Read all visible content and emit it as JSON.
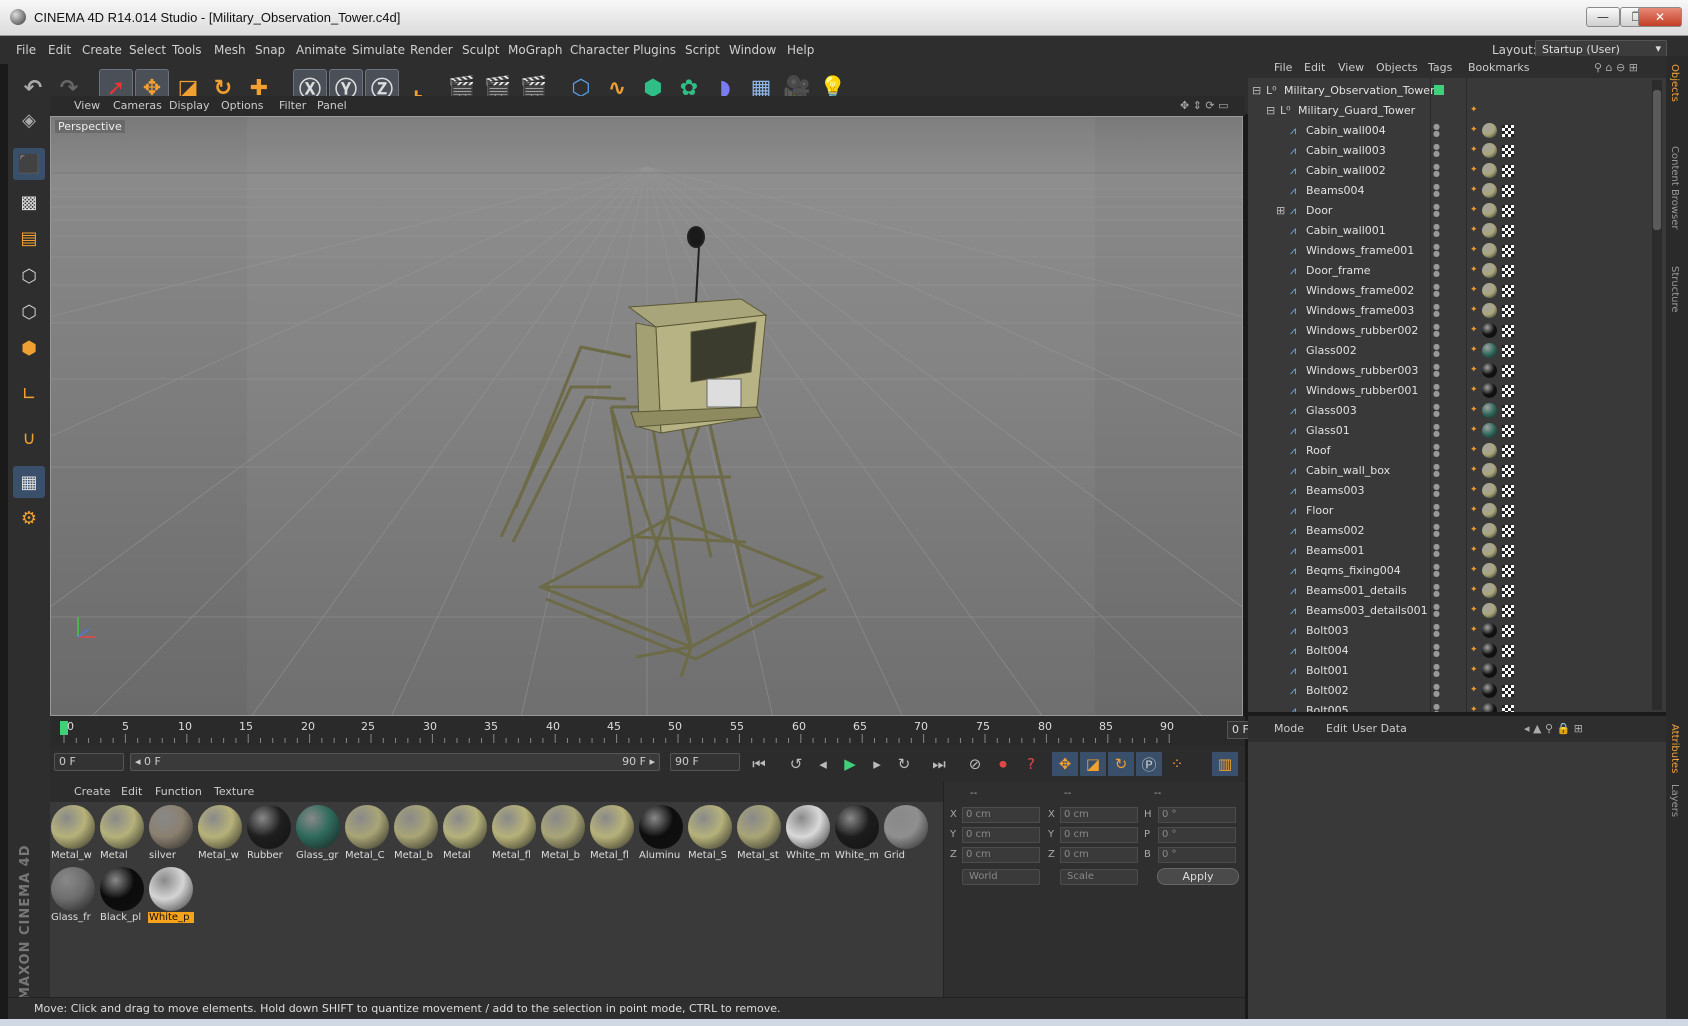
{
  "window": {
    "title": "CINEMA 4D R14.014 Studio - [Military_Observation_Tower.c4d]",
    "minimize": "—",
    "restore": "❐",
    "close": "✕"
  },
  "menubar": {
    "items": [
      "File",
      "Edit",
      "Create",
      "Select",
      "Tools",
      "Mesh",
      "Snap",
      "Animate",
      "Simulate",
      "Render",
      "Sculpt",
      "MoGraph",
      "Character",
      "Plugins",
      "Script",
      "Window",
      "Help"
    ],
    "layout_label": "Layout:",
    "layout_value": "Startup (User)"
  },
  "viewport": {
    "menu": [
      "View",
      "Cameras",
      "Display",
      "Options",
      "Filter",
      "Panel"
    ],
    "label": "Perspective"
  },
  "timeline": {
    "ticks": [
      "0",
      "5",
      "10",
      "15",
      "20",
      "25",
      "30",
      "35",
      "40",
      "45",
      "50",
      "55",
      "60",
      "65",
      "70",
      "75",
      "80",
      "85",
      "90"
    ],
    "current_frame": "0 F"
  },
  "transport": {
    "start_field": "0 F",
    "range_start": "◂ 0 F",
    "range_end": "90 F ▸",
    "end_field": "90 F"
  },
  "material_manager": {
    "menu": [
      "Create",
      "Edit",
      "Function",
      "Texture"
    ],
    "materials": [
      {
        "label": "Metal_w",
        "color": "#b7b27a"
      },
      {
        "label": "Metal",
        "color": "#b5b27b"
      },
      {
        "label": "silver",
        "color": "#8a8070"
      },
      {
        "label": "Metal_w",
        "color": "#b7b27a"
      },
      {
        "label": "Rubber",
        "color": "#1e1e1e"
      },
      {
        "label": "Glass_gr",
        "color": "#2e6a5c"
      },
      {
        "label": "Metal_C",
        "color": "#a9a577"
      },
      {
        "label": "Metal_b",
        "color": "#a9a577"
      },
      {
        "label": "Metal",
        "color": "#b5b27b"
      },
      {
        "label": "Metal_fl",
        "color": "#b7b27a"
      },
      {
        "label": "Metal_b",
        "color": "#a9a577"
      },
      {
        "label": "Metal_fl",
        "color": "#b7b27a"
      },
      {
        "label": "Aluminu",
        "color": "#0d0d0d"
      },
      {
        "label": "Metal_S",
        "color": "#b5b27b"
      },
      {
        "label": "Metal_st",
        "color": "#a9a577"
      },
      {
        "label": "White_m",
        "color": "#d9d9d9"
      },
      {
        "label": "White_m",
        "color": "#1c1c1c"
      },
      {
        "label": "Grid",
        "color": "#8f8f8f"
      },
      {
        "label": "Glass_fr",
        "color": "#6e6e6e"
      },
      {
        "label": "Black_pl",
        "color": "#0b0b0b"
      },
      {
        "label": "White_p",
        "color": "#d4d4d4"
      }
    ],
    "selected_index": 20
  },
  "coordinates": {
    "headers": [
      "--",
      "--",
      "--"
    ],
    "rows": [
      {
        "a": "X",
        "av": "0 cm",
        "b": "X",
        "bv": "0 cm",
        "c": "H",
        "cv": "0 °"
      },
      {
        "a": "Y",
        "av": "0 cm",
        "b": "Y",
        "bv": "0 cm",
        "c": "P",
        "cv": "0 °"
      },
      {
        "a": "Z",
        "av": "0 cm",
        "b": "Z",
        "bv": "0 cm",
        "c": "B",
        "cv": "0 °"
      }
    ],
    "space": "World",
    "mode": "Scale",
    "apply": "Apply"
  },
  "status": "Move: Click and drag to move elements. Hold down SHIFT to quantize movement / add to the selection in point mode, CTRL to remove.",
  "object_manager": {
    "menu": [
      "File",
      "Edit",
      "View",
      "Objects",
      "Tags",
      "Bookmarks"
    ],
    "root": "Military_Observation_Tower",
    "group": "Military_Guard_Tower",
    "objects": [
      {
        "name": "Cabin_wall004",
        "tag": "#aaa77a"
      },
      {
        "name": "Cabin_wall003",
        "tag": "#aaa77a"
      },
      {
        "name": "Cabin_wall002",
        "tag": "#aaa77a"
      },
      {
        "name": "Beams004",
        "tag": "#aaa77a"
      },
      {
        "name": "Door",
        "tag": "#aaa77a"
      },
      {
        "name": "Cabin_wall001",
        "tag": "#aaa77a"
      },
      {
        "name": "Windows_frame001",
        "tag": "#aaa77a"
      },
      {
        "name": "Door_frame",
        "tag": "#aaa77a"
      },
      {
        "name": "Windows_frame002",
        "tag": "#aaa77a"
      },
      {
        "name": "Windows_frame003",
        "tag": "#aaa77a"
      },
      {
        "name": "Windows_rubber002",
        "tag": "#111111"
      },
      {
        "name": "Glass002",
        "tag": "#2e6a5c"
      },
      {
        "name": "Windows_rubber003",
        "tag": "#111111"
      },
      {
        "name": "Windows_rubber001",
        "tag": "#111111"
      },
      {
        "name": "Glass003",
        "tag": "#2e6a5c"
      },
      {
        "name": "Glass01",
        "tag": "#2e6a5c"
      },
      {
        "name": "Roof",
        "tag": "#aaa77a"
      },
      {
        "name": "Cabin_wall_box",
        "tag": "#aaa77a"
      },
      {
        "name": "Beams003",
        "tag": "#aaa77a"
      },
      {
        "name": "Floor",
        "tag": "#aaa77a"
      },
      {
        "name": "Beams002",
        "tag": "#aaa77a"
      },
      {
        "name": "Beams001",
        "tag": "#aaa77a"
      },
      {
        "name": "Beqms_fixing004",
        "tag": "#aaa77a"
      },
      {
        "name": "Beams001_details",
        "tag": "#aaa77a"
      },
      {
        "name": "Beams003_details001",
        "tag": "#aaa77a"
      },
      {
        "name": "Bolt003",
        "tag": "#111111"
      },
      {
        "name": "Bolt004",
        "tag": "#111111"
      },
      {
        "name": "Bolt001",
        "tag": "#111111"
      },
      {
        "name": "Bolt002",
        "tag": "#111111"
      },
      {
        "name": "Bolt005",
        "tag": "#111111"
      }
    ]
  },
  "attributes": {
    "menu": [
      "Mode",
      "Edit",
      "User Data"
    ]
  },
  "right_tabs": [
    "Objects",
    "Content Browser",
    "Structure",
    "Attributes",
    "Layers"
  ],
  "logo": "MAXON CINEMA 4D"
}
